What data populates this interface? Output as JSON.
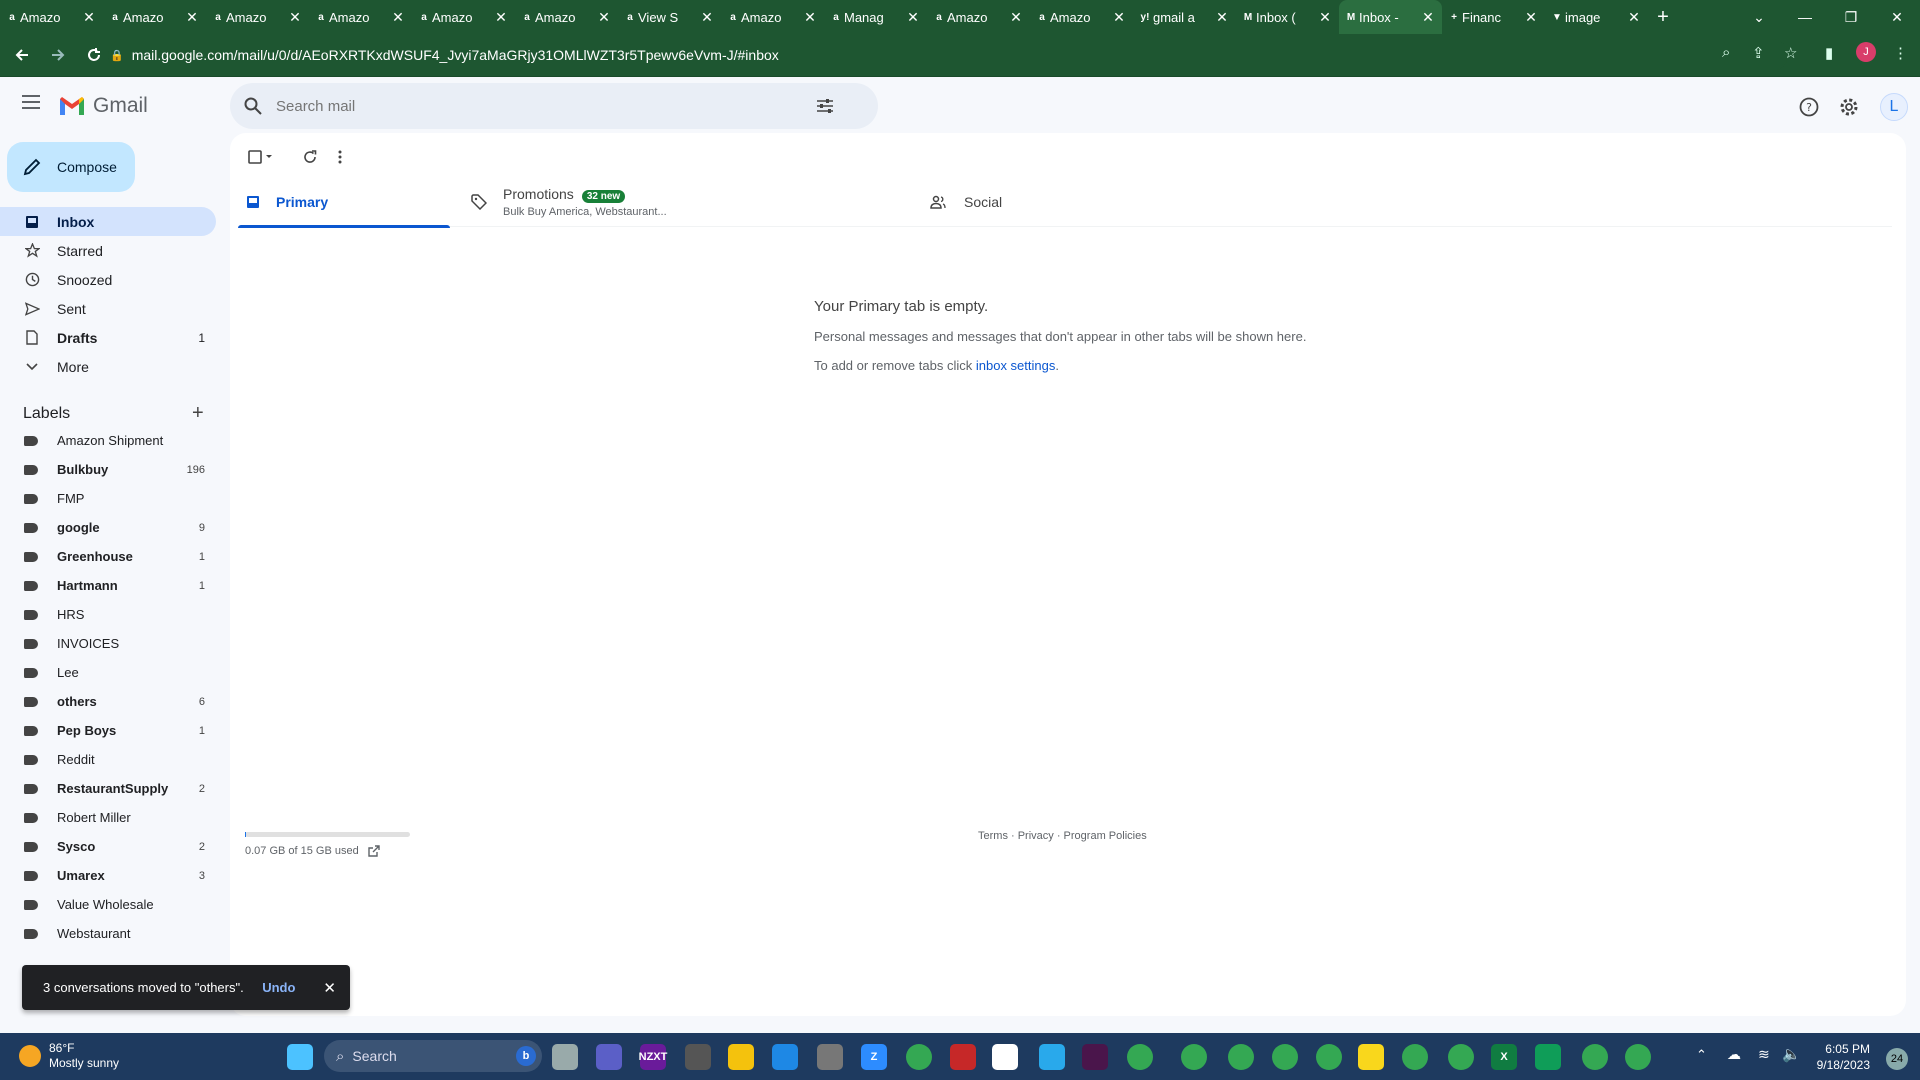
{
  "browser": {
    "tabs": [
      {
        "title": "Amazo",
        "fav": "a"
      },
      {
        "title": "Amazo",
        "fav": "a"
      },
      {
        "title": "Amazo",
        "fav": "a"
      },
      {
        "title": "Amazo",
        "fav": "a"
      },
      {
        "title": "Amazo",
        "fav": "a"
      },
      {
        "title": "Amazo",
        "fav": "a"
      },
      {
        "title": "View S",
        "fav": "a"
      },
      {
        "title": "Amazo",
        "fav": "a"
      },
      {
        "title": "Manag",
        "fav": "a"
      },
      {
        "title": "Amazo",
        "fav": "a"
      },
      {
        "title": "Amazo",
        "fav": "a"
      },
      {
        "title": "gmail a",
        "fav": "y!"
      },
      {
        "title": "Inbox (",
        "fav": "M"
      },
      {
        "title": "Inbox -",
        "fav": "M"
      },
      {
        "title": "Financ",
        "fav": "+"
      },
      {
        "title": "image",
        "fav": "▼"
      }
    ],
    "url": "mail.google.com/mail/u/0/d/AEoRXRTKxdWSUF4_Jvyi7aMaGRjy31OMLlWZT3r5Tpewv6eVvm-J/#inbox",
    "profile_initial": "J"
  },
  "gmail": {
    "brand": "Gmail",
    "search_placeholder": "Search mail",
    "avatar_initial": "L",
    "compose_label": "Compose",
    "nav": [
      {
        "label": "Inbox",
        "count": "",
        "icon": "inbox-icon"
      },
      {
        "label": "Starred",
        "count": "",
        "icon": "star-icon"
      },
      {
        "label": "Snoozed",
        "count": "",
        "icon": "clock-icon"
      },
      {
        "label": "Sent",
        "count": "",
        "icon": "send-icon"
      },
      {
        "label": "Drafts",
        "count": "1",
        "icon": "draft-icon"
      },
      {
        "label": "More",
        "count": "",
        "icon": "chevron-down-icon"
      }
    ],
    "labels_heading": "Labels",
    "labels": [
      {
        "label": "Amazon Shipment",
        "count": ""
      },
      {
        "label": "Bulkbuy",
        "count": "196"
      },
      {
        "label": "FMP",
        "count": ""
      },
      {
        "label": "google",
        "count": "9"
      },
      {
        "label": "Greenhouse",
        "count": "1"
      },
      {
        "label": "Hartmann",
        "count": "1"
      },
      {
        "label": "HRS",
        "count": ""
      },
      {
        "label": "INVOICES",
        "count": ""
      },
      {
        "label": "Lee",
        "count": ""
      },
      {
        "label": "others",
        "count": "6"
      },
      {
        "label": "Pep Boys",
        "count": "1"
      },
      {
        "label": "Reddit",
        "count": ""
      },
      {
        "label": "RestaurantSupply",
        "count": "2"
      },
      {
        "label": "Robert Miller",
        "count": ""
      },
      {
        "label": "Sysco",
        "count": "2"
      },
      {
        "label": "Umarex",
        "count": "3"
      },
      {
        "label": "Value Wholesale",
        "count": ""
      },
      {
        "label": "Webstaurant",
        "count": ""
      }
    ],
    "tabs": {
      "primary": "Primary",
      "promotions": "Promotions",
      "promotions_badge": "32 new",
      "promotions_sub": "Bulk Buy America, Webstaurant...",
      "social": "Social"
    },
    "empty": {
      "title": "Your Primary tab is empty.",
      "line1": "Personal messages and messages that don't appear in other tabs will be shown here.",
      "line2_prefix": "To add or remove tabs click ",
      "line2_link": "inbox settings",
      "line2_suffix": "."
    },
    "storage": {
      "text": "0.07 GB of 15 GB used",
      "fraction": 0.005
    },
    "footer": "Terms · Privacy · Program Policies",
    "toast": {
      "message": "3 conversations moved to \"others\".",
      "undo": "Undo"
    }
  },
  "taskbar": {
    "weather_temp": "86°F",
    "weather_desc": "Mostly sunny",
    "search_label": "Search",
    "time": "6:05 PM",
    "date": "9/18/2023",
    "notification_count": "24",
    "apps": [
      {
        "name": "windows-start-icon",
        "color": "#4cc2ff",
        "text": ""
      },
      {
        "name": "cortana-bing-icon",
        "color": "#2a6bd1",
        "text": "b"
      },
      {
        "name": "task-view-icon",
        "color": "#9aa",
        "text": ""
      },
      {
        "name": "teams-icon",
        "color": "#5b5fc7",
        "text": ""
      },
      {
        "name": "nzxt-icon",
        "color": "#6a1b9a",
        "text": "NZXT"
      },
      {
        "name": "app-icon",
        "color": "#555",
        "text": ""
      },
      {
        "name": "file-explorer-icon",
        "color": "#f4c20d",
        "text": ""
      },
      {
        "name": "calendar-icon",
        "color": "#1e88e5",
        "text": ""
      },
      {
        "name": "calculator-icon",
        "color": "#777",
        "text": ""
      },
      {
        "name": "zoom-icon",
        "color": "#2d8cff",
        "text": "Z"
      },
      {
        "name": "chrome-icon",
        "color": "#34a853",
        "text": ""
      },
      {
        "name": "photos-icon",
        "color": "#c62828",
        "text": ""
      },
      {
        "name": "chart-app-icon",
        "color": "#fff",
        "text": ""
      },
      {
        "name": "telegram-icon",
        "color": "#29a9eb",
        "text": ""
      },
      {
        "name": "slack-icon",
        "color": "#4a154b",
        "text": ""
      },
      {
        "name": "chrome-icon",
        "color": "#34a853",
        "text": ""
      },
      {
        "name": "chrome-icon",
        "color": "#34a853",
        "text": ""
      },
      {
        "name": "chrome-icon",
        "color": "#34a853",
        "text": ""
      },
      {
        "name": "chrome-icon",
        "color": "#34a853",
        "text": ""
      },
      {
        "name": "chrome-icon",
        "color": "#34a853",
        "text": ""
      },
      {
        "name": "sticky-notes-icon",
        "color": "#f9d71c",
        "text": ""
      },
      {
        "name": "chrome-icon",
        "color": "#34a853",
        "text": ""
      },
      {
        "name": "chrome-icon",
        "color": "#34a853",
        "text": ""
      },
      {
        "name": "excel-icon",
        "color": "#107c41",
        "text": "X"
      },
      {
        "name": "edge-icon",
        "color": "#0f9d58",
        "text": ""
      },
      {
        "name": "chrome-icon",
        "color": "#34a853",
        "text": ""
      },
      {
        "name": "chrome-icon",
        "color": "#34a853",
        "text": ""
      }
    ]
  },
  "colors": {
    "chrome_green": "#1e5631",
    "accent": "#0b57d0",
    "compose": "#c2e7ff",
    "inbox_active": "#d3e3fd"
  }
}
